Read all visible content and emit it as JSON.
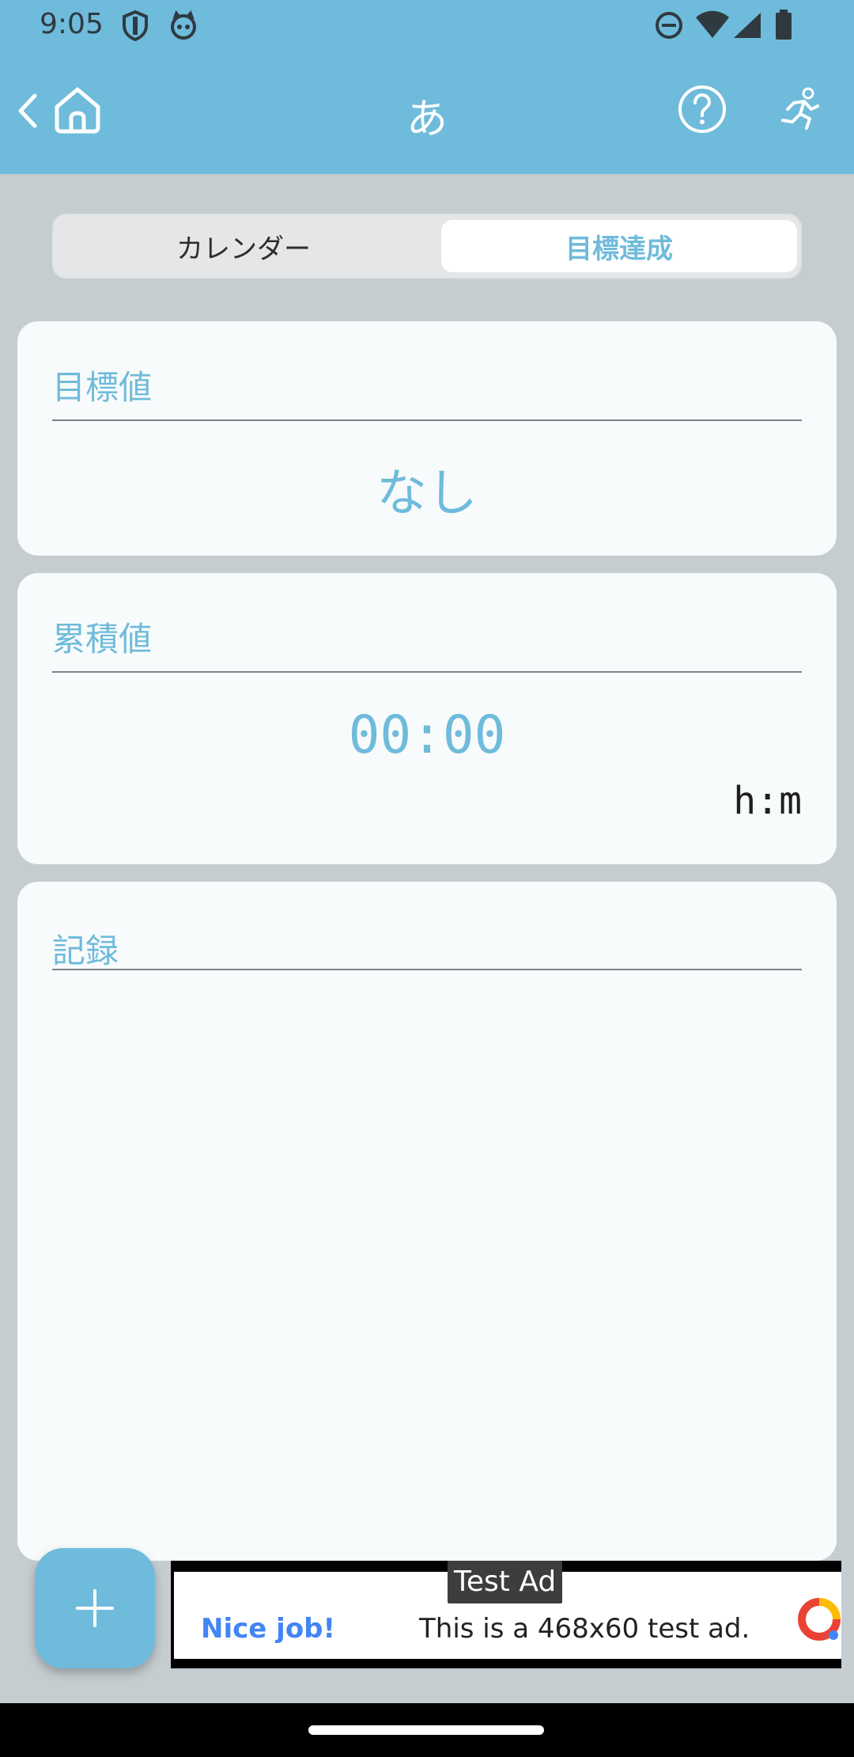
{
  "status": {
    "time": "9:05"
  },
  "app_bar": {
    "title": "あ"
  },
  "tabs": [
    {
      "label": "カレンダー",
      "selected": false
    },
    {
      "label": "目標達成",
      "selected": true
    }
  ],
  "target": {
    "label": "目標値",
    "value": "なし"
  },
  "cumulative": {
    "label": "累積値",
    "value": "00:00",
    "unit": "h:m"
  },
  "records": {
    "label": "記録"
  },
  "ad": {
    "badge": "Test Ad",
    "headline": "Nice job!",
    "text": "This is a 468x60 test ad."
  },
  "colors": {
    "accent": "#6fbbdb",
    "background": "#c5cdd1",
    "card": "#f8fbfb"
  }
}
